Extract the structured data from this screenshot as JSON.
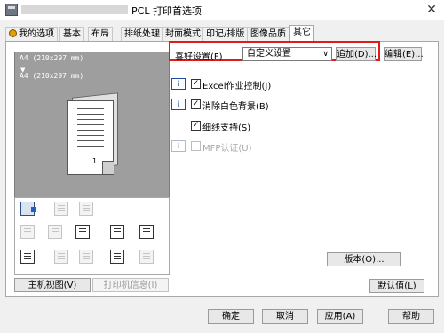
{
  "window": {
    "title": "PCL 打印首选项",
    "close_glyph": "✕"
  },
  "tabs": [
    {
      "label": "我的选项"
    },
    {
      "label": "基本"
    },
    {
      "label": "布局"
    },
    {
      "label": "排纸处理"
    },
    {
      "label": "封面模式"
    },
    {
      "label": "印记/排版"
    },
    {
      "label": "图像品质"
    },
    {
      "label": "其它",
      "active": true
    }
  ],
  "preview": {
    "paper_line1": "A4 (210x297 mm)",
    "arrow": "▼",
    "paper_line2": "A4 (210x297 mm)",
    "page_number": "1",
    "scale": "x1"
  },
  "left_buttons": {
    "printer_view": "主机视图(V)",
    "printer_info": "打印机信息(I)"
  },
  "favorites": {
    "label": "喜好设置(F)",
    "selected": "自定义设置",
    "add_button": "追加(D)...",
    "edit_button": "编辑(E)..."
  },
  "options": [
    {
      "label": "Excel作业控制(J)",
      "checked": true,
      "has_info": true,
      "enabled": true
    },
    {
      "label": "消除白色背景(B)",
      "checked": true,
      "has_info": true,
      "enabled": true
    },
    {
      "label": "细线支持(S)",
      "checked": true,
      "has_info": false,
      "enabled": true
    },
    {
      "label": "MFP认证(U)",
      "checked": false,
      "has_info": true,
      "enabled": false
    }
  ],
  "version_button": "版本(O)...",
  "default_button": "默认值(L)",
  "footer": {
    "ok": "确定",
    "cancel": "取消",
    "apply": "应用(A)",
    "help": "帮助"
  },
  "colors": {
    "highlight": "#e01b1b",
    "info_icon": "#1f4aa0",
    "preview_bg": "#9e9e9e"
  }
}
